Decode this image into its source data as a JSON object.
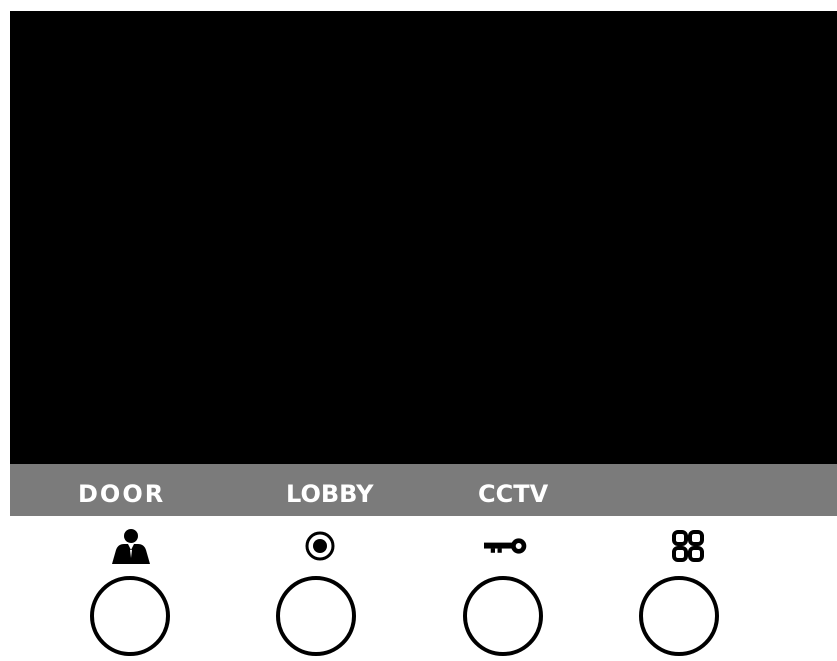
{
  "screen": {
    "background_color": "#000000"
  },
  "label_bar": {
    "background_color": "#7b7b7b",
    "labels": {
      "door": "DOOR",
      "lobby": "LOBBY",
      "cctv": "CCTV"
    }
  },
  "buttons": [
    {
      "icon": "person-icon"
    },
    {
      "icon": "record-icon"
    },
    {
      "icon": "key-icon"
    },
    {
      "icon": "grid-icon"
    }
  ]
}
